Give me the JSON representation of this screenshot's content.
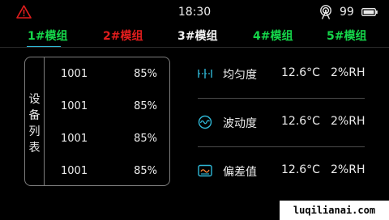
{
  "status_bar": {
    "time": "18:30",
    "signal_count": "99",
    "icons": {
      "warning": "warning-triangle-icon",
      "signal": "wireless-signal-icon",
      "battery": "battery-icon"
    },
    "colors": {
      "warning": "#e11d1d"
    }
  },
  "tabs": [
    {
      "label": "1#模组",
      "color": "#15d64a",
      "active": true
    },
    {
      "label": "2#模组",
      "color": "#e11d1d",
      "active": false
    },
    {
      "label": "3#模组",
      "color": "#f2f2f2",
      "active": false
    },
    {
      "label": "4#模组",
      "color": "#15d64a",
      "active": false
    },
    {
      "label": "5#模组",
      "color": "#15d64a",
      "active": false
    }
  ],
  "active_tab_underline_color": "#2fb8d6",
  "device_list": {
    "label_chars": [
      "设",
      "备",
      "列",
      "表"
    ],
    "rows": [
      {
        "id": "1001",
        "value": "85%"
      },
      {
        "id": "1001",
        "value": "85%"
      },
      {
        "id": "1001",
        "value": "85%"
      },
      {
        "id": "1001",
        "value": "85%"
      }
    ]
  },
  "stats": [
    {
      "label": "均匀度",
      "temp": "12.6°C",
      "humidity": "2%RH",
      "icon": "uniformity-icon"
    },
    {
      "label": "波动度",
      "temp": "12.6°C",
      "humidity": "2%RH",
      "icon": "fluctuation-icon"
    },
    {
      "label": "偏差值",
      "temp": "12.6°C",
      "humidity": "2%RH",
      "icon": "deviation-icon"
    }
  ],
  "stat_icon_color": "#2fb8d6",
  "watermark": "luqilianai.com"
}
